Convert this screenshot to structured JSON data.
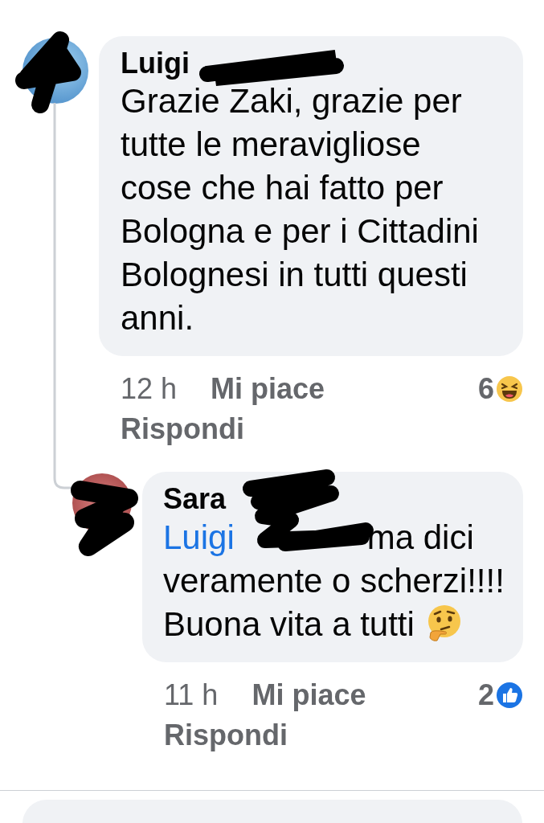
{
  "comments": [
    {
      "author": "Luigi",
      "text": "Grazie Zaki, grazie per tutte le meravigliose cose che hai fatto per Bologna e per i Cittadini Bolognesi in tutti questi anni.",
      "time": "12 h",
      "like_label": "Mi piace",
      "reply_label": "Rispondi",
      "reaction": {
        "kind": "haha",
        "count": "6"
      },
      "replies": [
        {
          "author": "Sara",
          "mention": "Luigi",
          "text": "ma dici veramente o scherzi!!!! Buona vita a tutti",
          "trailing_icon": {
            "kind": "thinking"
          },
          "time": "11 h",
          "like_label": "Mi piace",
          "reply_label": "Rispondi",
          "reaction": {
            "kind": "like",
            "count": "2"
          }
        }
      ]
    }
  ]
}
